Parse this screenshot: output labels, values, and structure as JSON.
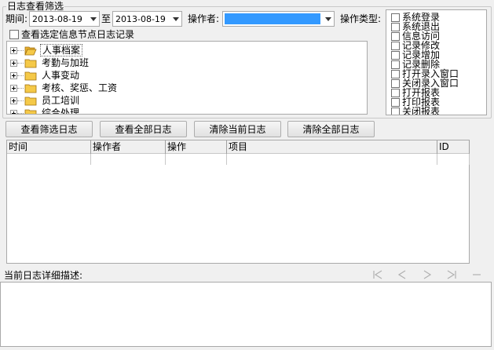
{
  "filter_group": {
    "title": "日志查看筛选"
  },
  "period": {
    "label": "期间:",
    "start": "2013-08-19",
    "to_label": "至",
    "end": "2013-08-19"
  },
  "operator": {
    "label": "操作者:",
    "value": ""
  },
  "op_type": {
    "label": "操作类型:",
    "items": [
      "系统登录",
      "系统退出",
      "信息访问",
      "记录修改",
      "记录增加",
      "记录删除",
      "打开录入窗口",
      "关闭录入窗口",
      "打开报表",
      "打印报表",
      "关闭报表"
    ]
  },
  "node_filter": {
    "label": "查看选定信息节点日志记录"
  },
  "tree": {
    "items": [
      {
        "label": "人事档案",
        "selected": true
      },
      {
        "label": "考勤与加班"
      },
      {
        "label": "人事变动"
      },
      {
        "label": "考核、奖惩、工资"
      },
      {
        "label": "员工培训"
      },
      {
        "label": "综合处理"
      }
    ]
  },
  "buttons": {
    "view_filtered": "查看筛选日志",
    "view_all": "查看全部日志",
    "clear_current": "清除当前日志",
    "clear_all": "清除全部日志"
  },
  "grid": {
    "columns": [
      "时间",
      "操作者",
      "操作",
      "项目",
      "ID"
    ]
  },
  "details": {
    "label": "当前日志详细描述:"
  },
  "nav_icons": [
    "first-record-icon",
    "prev-record-icon",
    "next-record-icon",
    "last-record-icon",
    "clear-icon"
  ],
  "colors": {
    "selection": "#3399ff",
    "folder": "#f5c948"
  }
}
